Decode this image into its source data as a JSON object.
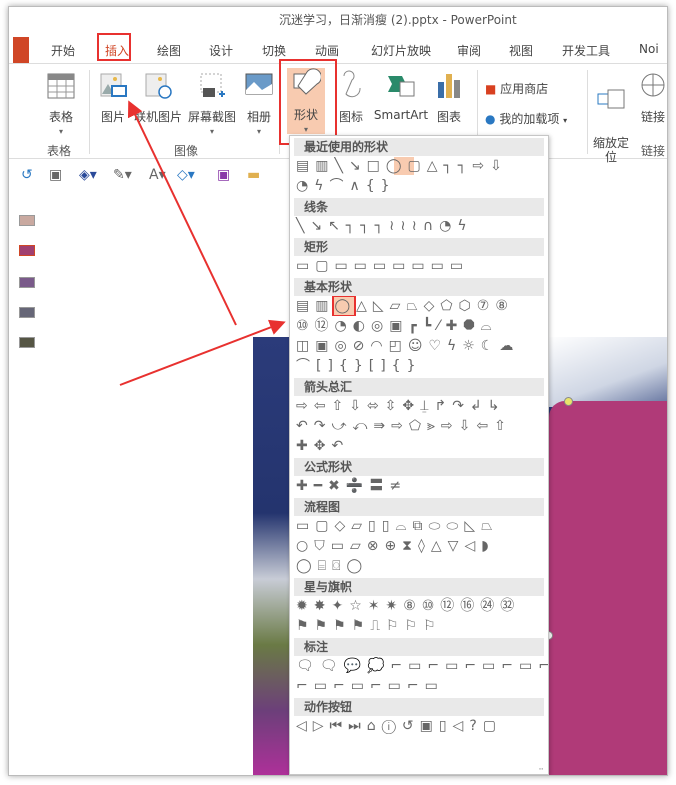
{
  "window": {
    "title": "沉迷学习，日渐消瘦 (2).pptx  -  PowerPoint"
  },
  "tabs": [
    "开始",
    "插入",
    "绘图",
    "设计",
    "切换",
    "动画",
    "幻灯片放映",
    "审阅",
    "视图",
    "开发工具",
    "Noi"
  ],
  "active_tab": "插入",
  "ribbon": {
    "table_btn": "表格",
    "table_group": "表格",
    "picture": "图片",
    "online_picture": "联机图片",
    "screenshot": "屏幕截图",
    "album": "相册",
    "image_group": "图像",
    "shapes": "形状",
    "icons": "图标",
    "smartart": "SmartArt",
    "chart": "图表",
    "store": "应用商店",
    "my_addins": "我的加载项",
    "zoom": "缩放定\n位",
    "link": "链接",
    "link_group": "链接"
  },
  "shapes_menu": {
    "sections": [
      {
        "title": "最近使用的形状",
        "rows": [
          "▤▥╲↘□◯▢△┐┐⇨⇩",
          "◔ϟ⌒∧{}"
        ],
        "selected": [
          0,
          5
        ]
      },
      {
        "title": "线条",
        "rows": [
          "╲↘↖┐┐┐≀≀≀∩◔ϟ"
        ]
      },
      {
        "title": "矩形",
        "rows": [
          "▭▢▭▭▭▭▭▭▭"
        ]
      },
      {
        "title": "基本形状",
        "rows": [
          "▤▥◯△◺▱⏢◇⬠⬡⑦⑧",
          "⑩⑫◔◐◎▣┏┗⁄✚⯃⌓",
          "◫▣◎⊘◠◰☺♡ϟ☼☾☁",
          "⌒[]{}[]{}"
        ],
        "selected": [
          0,
          2
        ]
      },
      {
        "title": "箭头总汇",
        "rows": [
          "⇨⇦⇧⇩⬄⇳✥⍊↱↷↲↳",
          "↶↷⤻⤺⇛⇨⬠⪢⇨⇩⇦⇧",
          "✚✥↶"
        ]
      },
      {
        "title": "公式形状",
        "rows": [
          "✚━✖➗〓≠"
        ]
      },
      {
        "title": "流程图",
        "rows": [
          "▭▢◇▱▯▯⌓⧉⬭⬭◺⏢",
          "○⛉▭⏥⊗⊕⧗◊△▽◁◗",
          "◯⌸⌼◯"
        ]
      },
      {
        "title": "星与旗帜",
        "rows": [
          "✹✸✦☆✶✷⑧⑩⑫⑯㉔㉜",
          "⚑⚑⚑⚑⎍⚐⚐⚐"
        ]
      },
      {
        "title": "标注",
        "rows": [
          "🗨🗨💬💭⌐▭⌐▭⌐▭⌐▭⌐▭⌐▭⌐▭⌐▭",
          "⌐▭⌐▭⌐▭⌐▭"
        ]
      },
      {
        "title": "动作按钮",
        "rows": [
          "◁▷⏮⏭⌂ⓘ↺▣▯◁?▢"
        ]
      }
    ]
  },
  "colors": {
    "accent": "#d04626",
    "highlight": "#e8312f",
    "slide_shape": "#b03a78"
  }
}
